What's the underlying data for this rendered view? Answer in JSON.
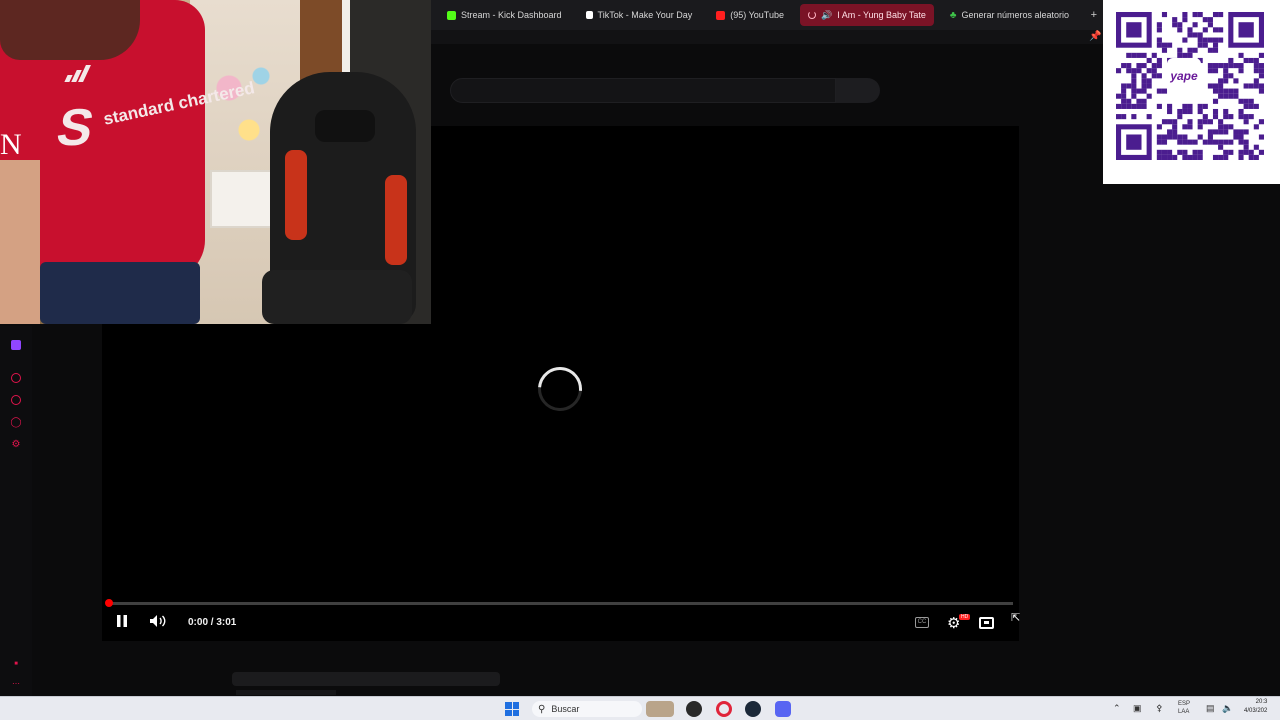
{
  "browser": {
    "tabs": [
      {
        "label": "Stream - Kick Dashboard",
        "icon": "kick-icon",
        "active": false
      },
      {
        "label": "TikTok - Make Your Day",
        "icon": "tiktok-icon",
        "active": false
      },
      {
        "label": "(95) YouTube",
        "icon": "youtube-icon",
        "active": false
      },
      {
        "label": "I Am - Yung Baby Tate",
        "icon": "speaker-icon",
        "active": true
      },
      {
        "label": "Generar números aleatorio",
        "icon": "clover-icon",
        "active": false
      }
    ],
    "new_tab_label": "+"
  },
  "webcam": {
    "overlay_letter": "N",
    "shirt_text": "standard chartered"
  },
  "player": {
    "time_display": "0:00 / 3:01",
    "progress": 0.0,
    "state": "loading",
    "quality_badge": "HD"
  },
  "qr": {
    "brand": "yape"
  },
  "taskbar": {
    "search_placeholder": "Buscar",
    "language": "ESP",
    "language_sub": "LAA",
    "time": "20:3",
    "date": "4/03/202"
  },
  "colors": {
    "accent": "#e0144c",
    "progress_red": "#ff0000",
    "active_tab": "#7a1326",
    "qr_purple": "#4b1d8f"
  }
}
